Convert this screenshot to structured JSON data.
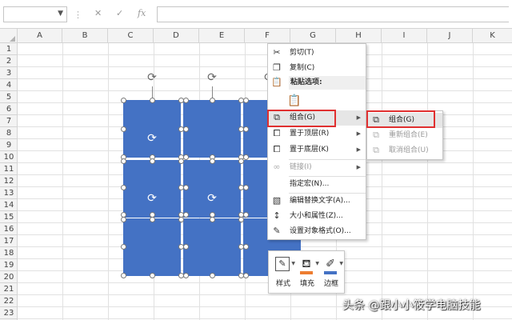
{
  "formula_bar": {
    "name_box_value": "",
    "cancel_icon": "x-icon",
    "enter_icon": "check-icon",
    "function_icon": "fx-icon",
    "fx_label": "fx",
    "formula_value": ""
  },
  "columns": [
    "A",
    "B",
    "C",
    "D",
    "E",
    "F",
    "G",
    "H",
    "I",
    "J",
    "K"
  ],
  "rows": [
    "1",
    "2",
    "3",
    "4",
    "5",
    "6",
    "7",
    "8",
    "9",
    "10",
    "11",
    "12",
    "13",
    "14",
    "15",
    "16",
    "17",
    "18",
    "19",
    "20",
    "21",
    "22",
    "23"
  ],
  "shapes": {
    "fill_color": "#4472c4",
    "handle_color": "#ffffff"
  },
  "context_menu": {
    "items": [
      {
        "label": "剪切(T)",
        "icon": "scissors-icon"
      },
      {
        "label": "复制(C)",
        "icon": "copy-icon"
      },
      {
        "label": "粘贴选项:",
        "icon": "paste-icon"
      },
      {
        "label": "组合(G)",
        "icon": "group-icon",
        "has_submenu": true
      },
      {
        "label": "置于顶层(R)",
        "icon": "bring-front-icon",
        "has_submenu": true
      },
      {
        "label": "置于底层(K)",
        "icon": "send-back-icon",
        "has_submenu": true
      },
      {
        "label": "链接(I)",
        "icon": "link-icon",
        "has_submenu": true,
        "disabled": true
      },
      {
        "label": "指定宏(N)...",
        "icon": ""
      },
      {
        "label": "编辑替换文字(A)...",
        "icon": "alt-text-icon"
      },
      {
        "label": "大小和属性(Z)...",
        "icon": "size-icon"
      },
      {
        "label": "设置对象格式(O)...",
        "icon": "format-icon"
      }
    ],
    "highlight_color": "#e03030"
  },
  "submenu": {
    "items": [
      {
        "label": "组合(G)",
        "icon": "group-icon"
      },
      {
        "label": "重新组合(E)",
        "icon": "regroup-icon",
        "disabled": true
      },
      {
        "label": "取消组合(U)",
        "icon": "ungroup-icon",
        "disabled": true
      }
    ]
  },
  "mini_toolbar": {
    "buttons": [
      {
        "label": "样式",
        "icon": "style-icon"
      },
      {
        "label": "填充",
        "icon": "fill-bucket-icon",
        "swatch": "#ed7d31"
      },
      {
        "label": "边框",
        "icon": "outline-pen-icon",
        "swatch": "#4472c4"
      }
    ]
  },
  "watermark": "头条 @跟小小筱学电脑技能"
}
